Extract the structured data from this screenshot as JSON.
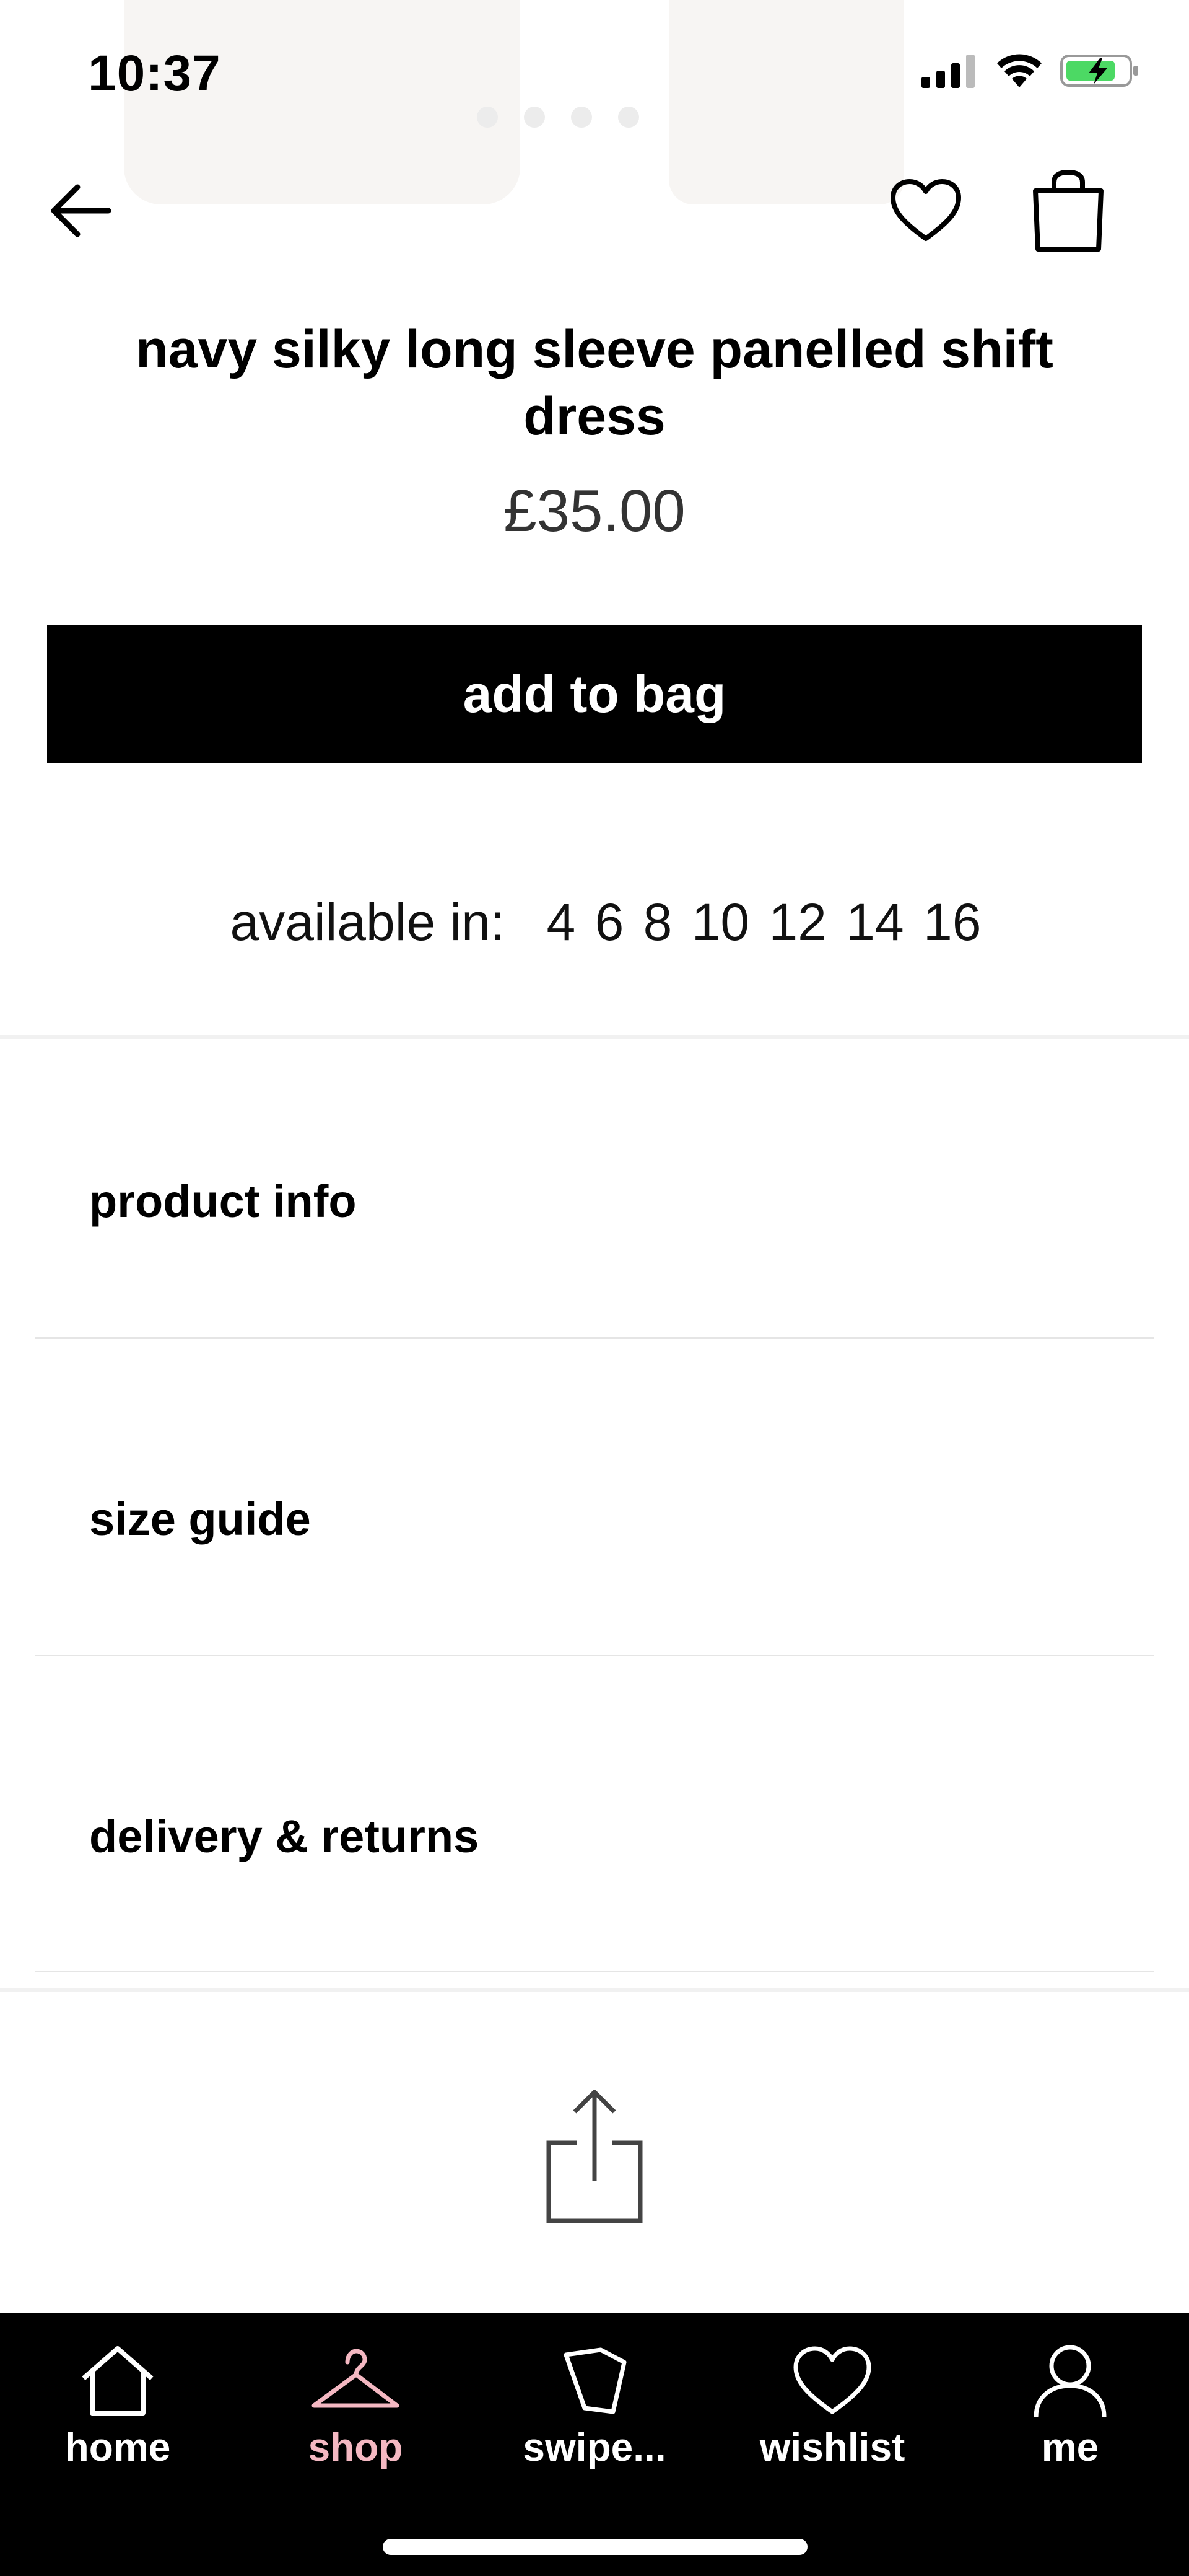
{
  "status_bar": {
    "time": "10:37"
  },
  "product": {
    "title": "navy silky long sleeve panelled shift dress",
    "price": "£35.00",
    "add_to_bag_label": "add to bag",
    "available_label": "available in:",
    "sizes": [
      "4",
      "6",
      "8",
      "10",
      "12",
      "14",
      "16"
    ]
  },
  "accordion": [
    {
      "label": "product info"
    },
    {
      "label": "size guide"
    },
    {
      "label": "delivery & returns"
    }
  ],
  "tab_bar": {
    "items": [
      {
        "label": "home",
        "icon": "home-icon"
      },
      {
        "label": "shop",
        "icon": "hanger-icon"
      },
      {
        "label": "swipe...",
        "icon": "cards-icon"
      },
      {
        "label": "wishlist",
        "icon": "heart-icon"
      },
      {
        "label": "me",
        "icon": "user-icon"
      }
    ],
    "active": "shop",
    "active_color": "#f4b8c2"
  },
  "colors": {
    "primary_button": "#000000",
    "battery": "#4cd964"
  }
}
